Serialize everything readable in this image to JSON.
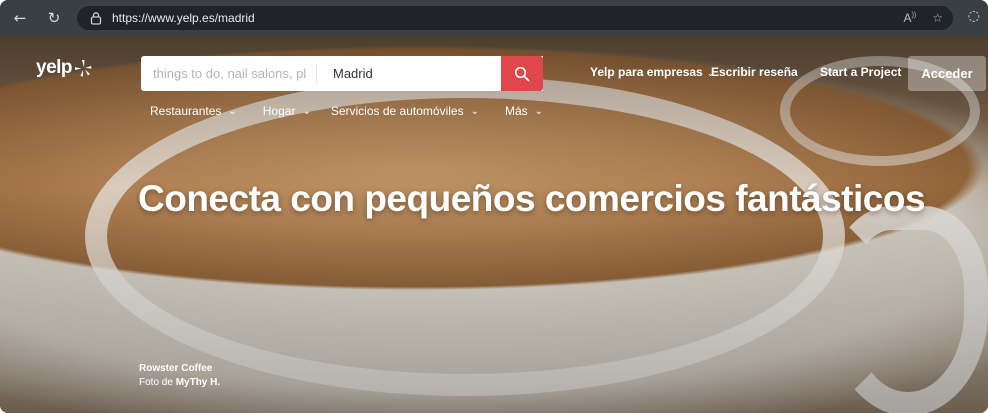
{
  "browser": {
    "url": "https://www.yelp.es/madrid"
  },
  "header": {
    "logo_text": "yelp",
    "search_placeholder": "things to do, nail salons, pl",
    "location_value": "Madrid",
    "nav": {
      "business": "Yelp para empresas",
      "write_review": "Escribir reseña",
      "start_project": "Start a Project",
      "login": "Acceder"
    },
    "categories": [
      {
        "label": "Restaurantes"
      },
      {
        "label": "Hogar"
      },
      {
        "label": "Servicios de automóviles"
      },
      {
        "label": "Más"
      }
    ]
  },
  "hero": {
    "headline": "Conecta con pequeños comercios fantásticos",
    "credit": {
      "business": "Rowster Coffee",
      "photo_prefix": "Foto de",
      "photographer": "MyThy H."
    }
  },
  "colors": {
    "accent": "#e0464b",
    "chrome": "#3a3f46",
    "urlbar": "#202327"
  },
  "icons": [
    "back-arrow-icon",
    "refresh-icon",
    "lock-icon",
    "read-aloud-icon",
    "favorite-star-icon",
    "copilot-icon",
    "yelp-burst-icon",
    "search-icon",
    "chevron-down-icon"
  ]
}
